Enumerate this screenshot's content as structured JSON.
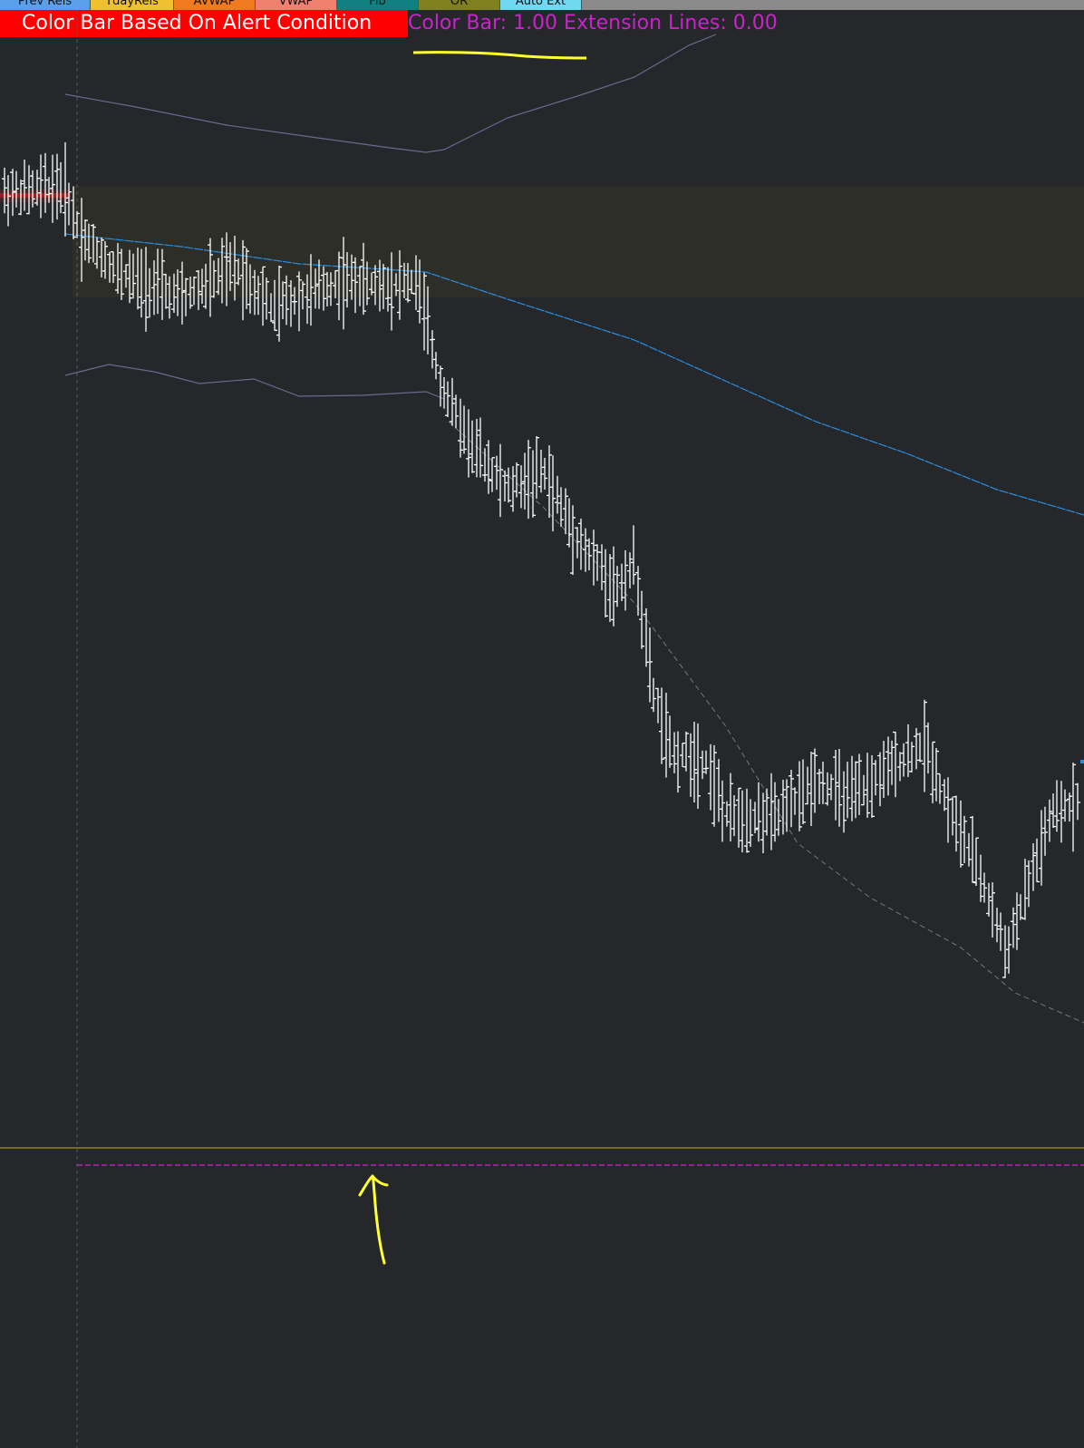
{
  "tabs": [
    {
      "label": "Prev Rels",
      "color": "#5aa0e8"
    },
    {
      "label": "TdayRels",
      "color": "#f0c030"
    },
    {
      "label": "AVWAP",
      "color": "#f07a20"
    },
    {
      "label": "VWAP",
      "color": "#f08070"
    },
    {
      "label": "Fib",
      "color": "#108080"
    },
    {
      "label": "OR",
      "color": "#808020"
    },
    {
      "label": "Auto Ext",
      "color": "#70d8f0"
    }
  ],
  "study": {
    "title": "Color Bar Based On Alert Condition",
    "status": "Color Bar: 1.00  Extension Lines: 0.00"
  },
  "colors": {
    "background": "#25272b",
    "bars": "#ffffff",
    "trend_line": "#2a8ee0",
    "band_line": "#6a6a8c",
    "channel_line": "#777777",
    "zone": "#2d2e28",
    "session_line": "#c8b400",
    "alert_line": "#cc22cc",
    "annotation": "#ffff33"
  },
  "annotations": {
    "arrow": "hand-drawn-arrow"
  }
}
